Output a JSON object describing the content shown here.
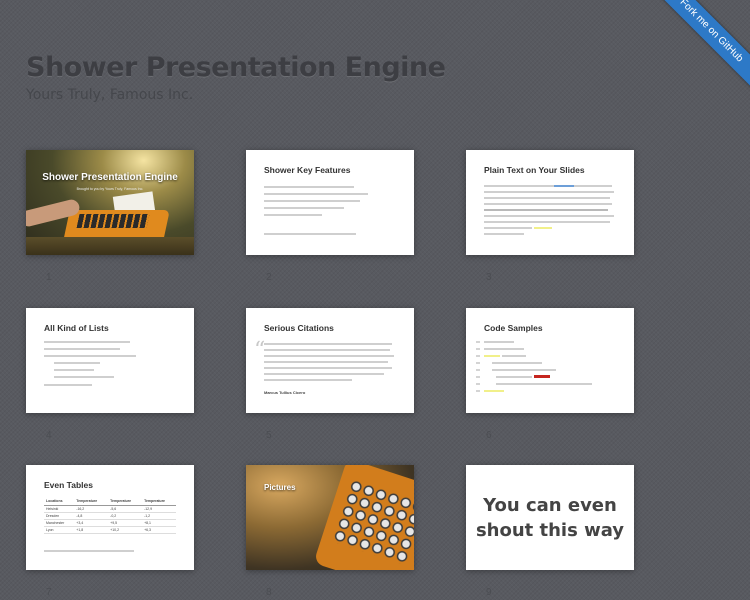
{
  "header": {
    "title": "Shower Presentation Engine",
    "subtitle": "Yours Truly, Famous Inc."
  },
  "fork_ribbon": {
    "label": "Fork me on GitHub"
  },
  "slides": [
    {
      "number": "1",
      "title": "Shower Presentation Engine",
      "subtitle": "Brought to you by Yours Truly, Famous Inc.",
      "type": "cover"
    },
    {
      "number": "2",
      "title": "Shower Key Features",
      "type": "list"
    },
    {
      "number": "3",
      "title": "Plain Text on Your Slides",
      "type": "text"
    },
    {
      "number": "4",
      "title": "All Kind of Lists",
      "type": "list"
    },
    {
      "number": "5",
      "title": "Serious Citations",
      "author": "Marcus Tullius Cicero",
      "type": "quote"
    },
    {
      "number": "6",
      "title": "Code Samples",
      "type": "code"
    },
    {
      "number": "7",
      "title": "Even Tables",
      "type": "table",
      "table": {
        "headers": [
          "Locations",
          "Temperature",
          "Temperature",
          "Temperature"
        ],
        "rows": [
          [
            "Helsinki",
            "-16,2",
            "-5,6",
            "-12,9"
          ],
          [
            "Dresden",
            "-4,8",
            "-0,2",
            "-1,2"
          ],
          [
            "Manchester",
            "+3,4",
            "+9,5",
            "+8,1"
          ],
          [
            "Lyon",
            "+1,8",
            "+10,2",
            "+6,3"
          ]
        ]
      }
    },
    {
      "number": "8",
      "title": "Pictures",
      "type": "picture"
    },
    {
      "number": "9",
      "title": "You can even\nshout this way",
      "type": "shout"
    }
  ]
}
